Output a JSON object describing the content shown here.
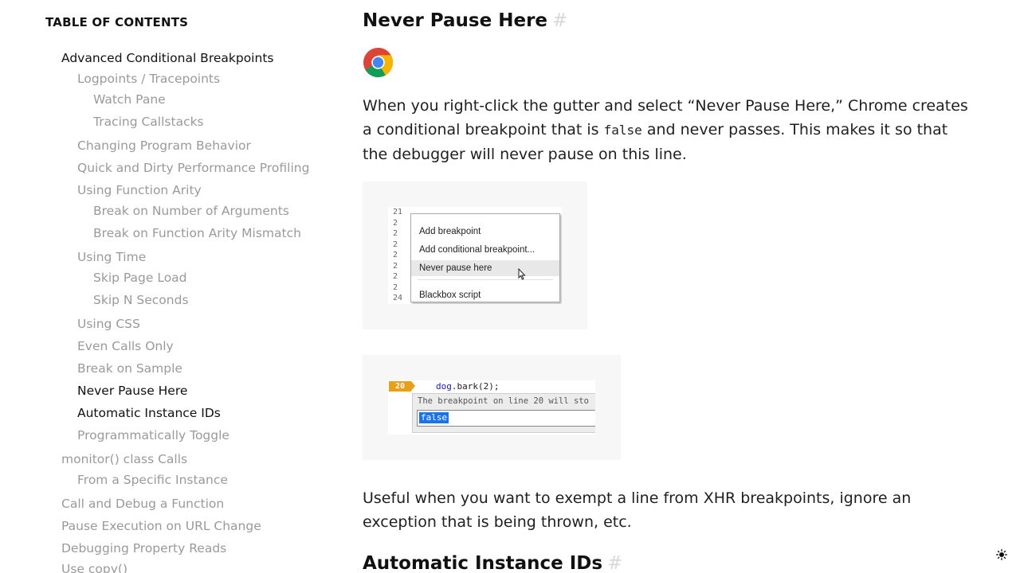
{
  "toc": {
    "title": "TABLE OF CONTENTS",
    "items": [
      {
        "label": "Advanced Conditional Breakpoints",
        "level": 1,
        "active": true
      },
      {
        "label": "Logpoints / Tracepoints",
        "level": 2,
        "active": false
      },
      {
        "label": "Watch Pane",
        "level": 3,
        "active": false
      },
      {
        "label": "Tracing Callstacks",
        "level": 3,
        "active": false
      },
      {
        "label": "Changing Program Behavior",
        "level": 2,
        "active": false
      },
      {
        "label": "Quick and Dirty Performance Profiling",
        "level": 2,
        "active": false
      },
      {
        "label": "Using Function Arity",
        "level": 2,
        "active": false
      },
      {
        "label": "Break on Number of Arguments",
        "level": 3,
        "active": false
      },
      {
        "label": "Break on Function Arity Mismatch",
        "level": 3,
        "active": false
      },
      {
        "label": "Using Time",
        "level": 2,
        "active": false
      },
      {
        "label": "Skip Page Load",
        "level": 3,
        "active": false
      },
      {
        "label": "Skip N Seconds",
        "level": 3,
        "active": false
      },
      {
        "label": "Using CSS",
        "level": 2,
        "active": false
      },
      {
        "label": "Even Calls Only",
        "level": 2,
        "active": false
      },
      {
        "label": "Break on Sample",
        "level": 2,
        "active": false
      },
      {
        "label": "Never Pause Here",
        "level": 2,
        "active": true
      },
      {
        "label": "Automatic Instance IDs",
        "level": 2,
        "active": true
      },
      {
        "label": "Programmatically Toggle",
        "level": 2,
        "active": false
      },
      {
        "label": "monitor() class Calls",
        "level": 1,
        "active": false
      },
      {
        "label": "From a Specific Instance",
        "level": 2,
        "active": false
      },
      {
        "label": "Call and Debug a Function",
        "level": 1,
        "active": false
      },
      {
        "label": "Pause Execution on URL Change",
        "level": 1,
        "active": false
      },
      {
        "label": "Debugging Property Reads",
        "level": 1,
        "active": false
      },
      {
        "label": "Use copy()",
        "level": 1,
        "active": false
      }
    ]
  },
  "article": {
    "section1": {
      "heading": "Never Pause Here",
      "anchor": "#",
      "icon": "chrome-logo-icon",
      "para1_a": "When you right-click the gutter and select “Never Pause Here,” Chrome creates a conditional breakpoint that is ",
      "para1_code": "false",
      "para1_b": " and never passes. This makes it so that the debugger will never pause on this line.",
      "para2": "Useful when you want to exempt a line from XHR breakpoints, ignore an exception that is being thrown, etc."
    },
    "context_menu_figure": {
      "gutter_numbers": [
        "21",
        "2",
        "2",
        "2",
        "2",
        "2",
        "2",
        "2",
        "24"
      ],
      "items": [
        "Add breakpoint",
        "Add conditional breakpoint...",
        "Never pause here",
        "Blackbox script"
      ],
      "hovered_item": "Never pause here"
    },
    "breakpoint_figure": {
      "line_number": "20",
      "code_obj": "dog",
      "code_call": ".bark(2);",
      "message": "The breakpoint on line 20 will sto",
      "condition_value": "false"
    },
    "section2": {
      "heading": "Automatic Instance IDs",
      "anchor": "#"
    }
  },
  "theme_toggle_icon": "sun-icon",
  "colors": {
    "toc_inactive": "#9a9a9a",
    "toc_active": "#111111",
    "anchor": "#d8d8d8",
    "breakpoint_badge": "#e89f1a",
    "selection": "#1a73e8"
  }
}
